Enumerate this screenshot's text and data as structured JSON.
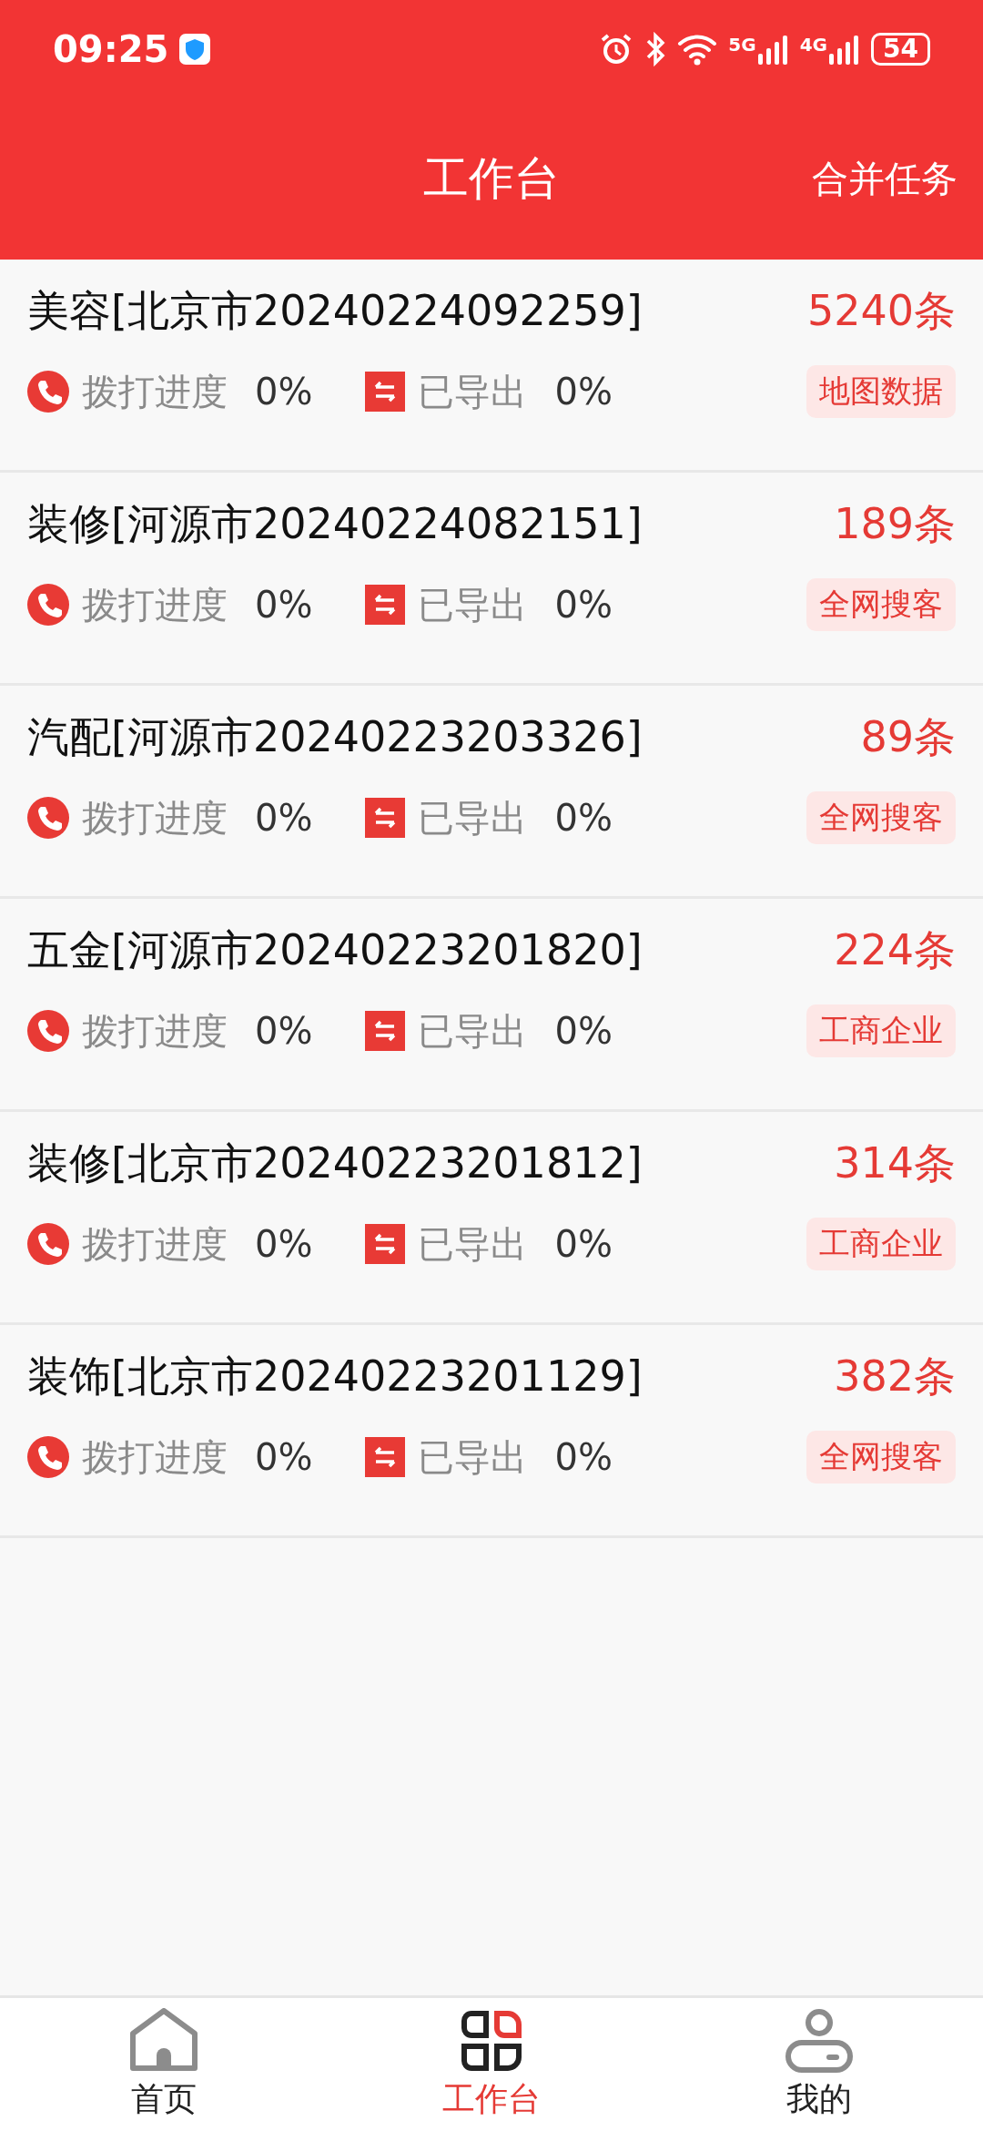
{
  "status_bar": {
    "time": "09:25",
    "networks": [
      "5G",
      "4G"
    ],
    "battery": "54"
  },
  "header": {
    "title": "工作台",
    "action": "合并任务"
  },
  "tasks": [
    {
      "title": "美容[北京市20240224092259]",
      "count": "5240条",
      "call_label": "拨打进度",
      "call_value": "0%",
      "export_label": "已导出",
      "export_value": "0%",
      "tag": "地图数据"
    },
    {
      "title": "装修[河源市20240224082151]",
      "count": "189条",
      "call_label": "拨打进度",
      "call_value": "0%",
      "export_label": "已导出",
      "export_value": "0%",
      "tag": "全网搜客"
    },
    {
      "title": "汽配[河源市20240223203326]",
      "count": "89条",
      "call_label": "拨打进度",
      "call_value": "0%",
      "export_label": "已导出",
      "export_value": "0%",
      "tag": "全网搜客"
    },
    {
      "title": "五金[河源市20240223201820]",
      "count": "224条",
      "call_label": "拨打进度",
      "call_value": "0%",
      "export_label": "已导出",
      "export_value": "0%",
      "tag": "工商企业"
    },
    {
      "title": "装修[北京市20240223201812]",
      "count": "314条",
      "call_label": "拨打进度",
      "call_value": "0%",
      "export_label": "已导出",
      "export_value": "0%",
      "tag": "工商企业"
    },
    {
      "title": "装饰[北京市20240223201129]",
      "count": "382条",
      "call_label": "拨打进度",
      "call_value": "0%",
      "export_label": "已导出",
      "export_value": "0%",
      "tag": "全网搜客"
    }
  ],
  "nav": [
    {
      "label": "首页",
      "kind": "home",
      "selected": false
    },
    {
      "label": "工作台",
      "kind": "workbench",
      "selected": true
    },
    {
      "label": "我的",
      "kind": "profile",
      "selected": false
    }
  ]
}
